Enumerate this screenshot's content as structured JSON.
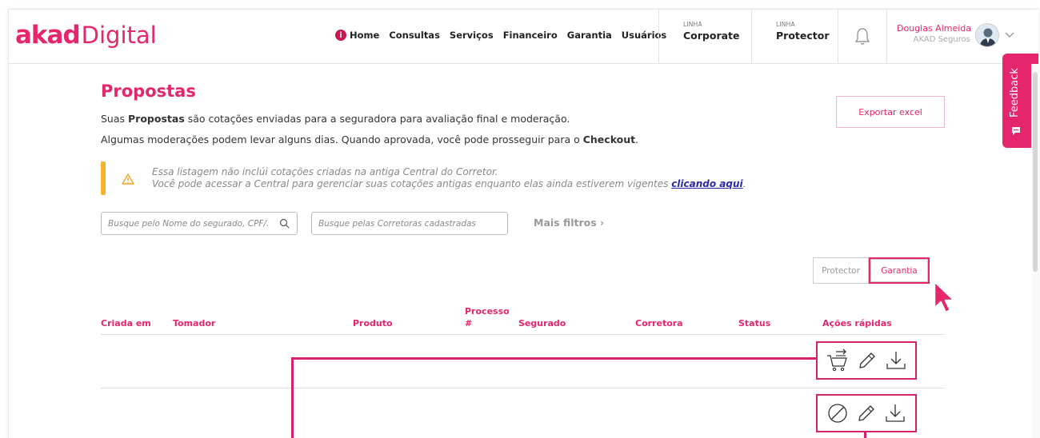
{
  "header": {
    "logo_brand": "akad",
    "logo_product": "Digital",
    "nav": [
      "Home",
      "Consultas",
      "Serviços",
      "Financeiro",
      "Garantia",
      "Usuários"
    ],
    "lines": [
      {
        "small": "LINHA",
        "name": "Corporate"
      },
      {
        "small": "LINHA",
        "name": "Protector"
      }
    ],
    "user": {
      "name": "Douglas Almeida",
      "company": "AKAD Seguros"
    }
  },
  "feedback_label": "Feedback",
  "page": {
    "title": "Propostas",
    "desc1_pre": "Suas ",
    "desc1_bold": "Propostas",
    "desc1_post": " são cotações enviadas para a seguradora para avaliação final e moderação.",
    "desc2_pre": "Algumas moderações podem levar alguns dias. Quando aprovada, você pode prosseguir para o ",
    "desc2_bold": "Checkout",
    "desc2_post": ".",
    "export_label": "Exportar excel"
  },
  "warning": {
    "line1": "Essa listagem não inclúi cotações criadas na antiga Central do Corretor.",
    "line2_pre": "Você pode acessar a Central para gerenciar suas cotações antigas enquanto elas ainda estiverem vigentes ",
    "line2_link": "clicando aqui",
    "line2_post": "."
  },
  "filters": {
    "search_placeholder": "Busque pelo Nome do segurado, CPF/...",
    "broker_placeholder": "Busque pelas Corretoras cadastradas",
    "more_filters": "Mais filtros ›"
  },
  "toggle": {
    "protector": "Protector",
    "garantia": "Garantia"
  },
  "table": {
    "headers": {
      "created": "Criada em",
      "tomador": "Tomador",
      "produto": "Produto",
      "processo_1": "Processo",
      "processo_2": "#",
      "segurado": "Segurado",
      "corretora": "Corretora",
      "status": "Status",
      "acoes": "Ações rápidas"
    },
    "rows": [
      {
        "actions": [
          "cart-arrow-icon",
          "pencil-icon",
          "download-icon"
        ]
      },
      {
        "actions": [
          "cancel-icon",
          "pencil-icon",
          "download-icon"
        ]
      }
    ]
  },
  "colors": {
    "accent": "#e5266c",
    "warning": "#f5b22c",
    "highlight": "#d6226a"
  }
}
